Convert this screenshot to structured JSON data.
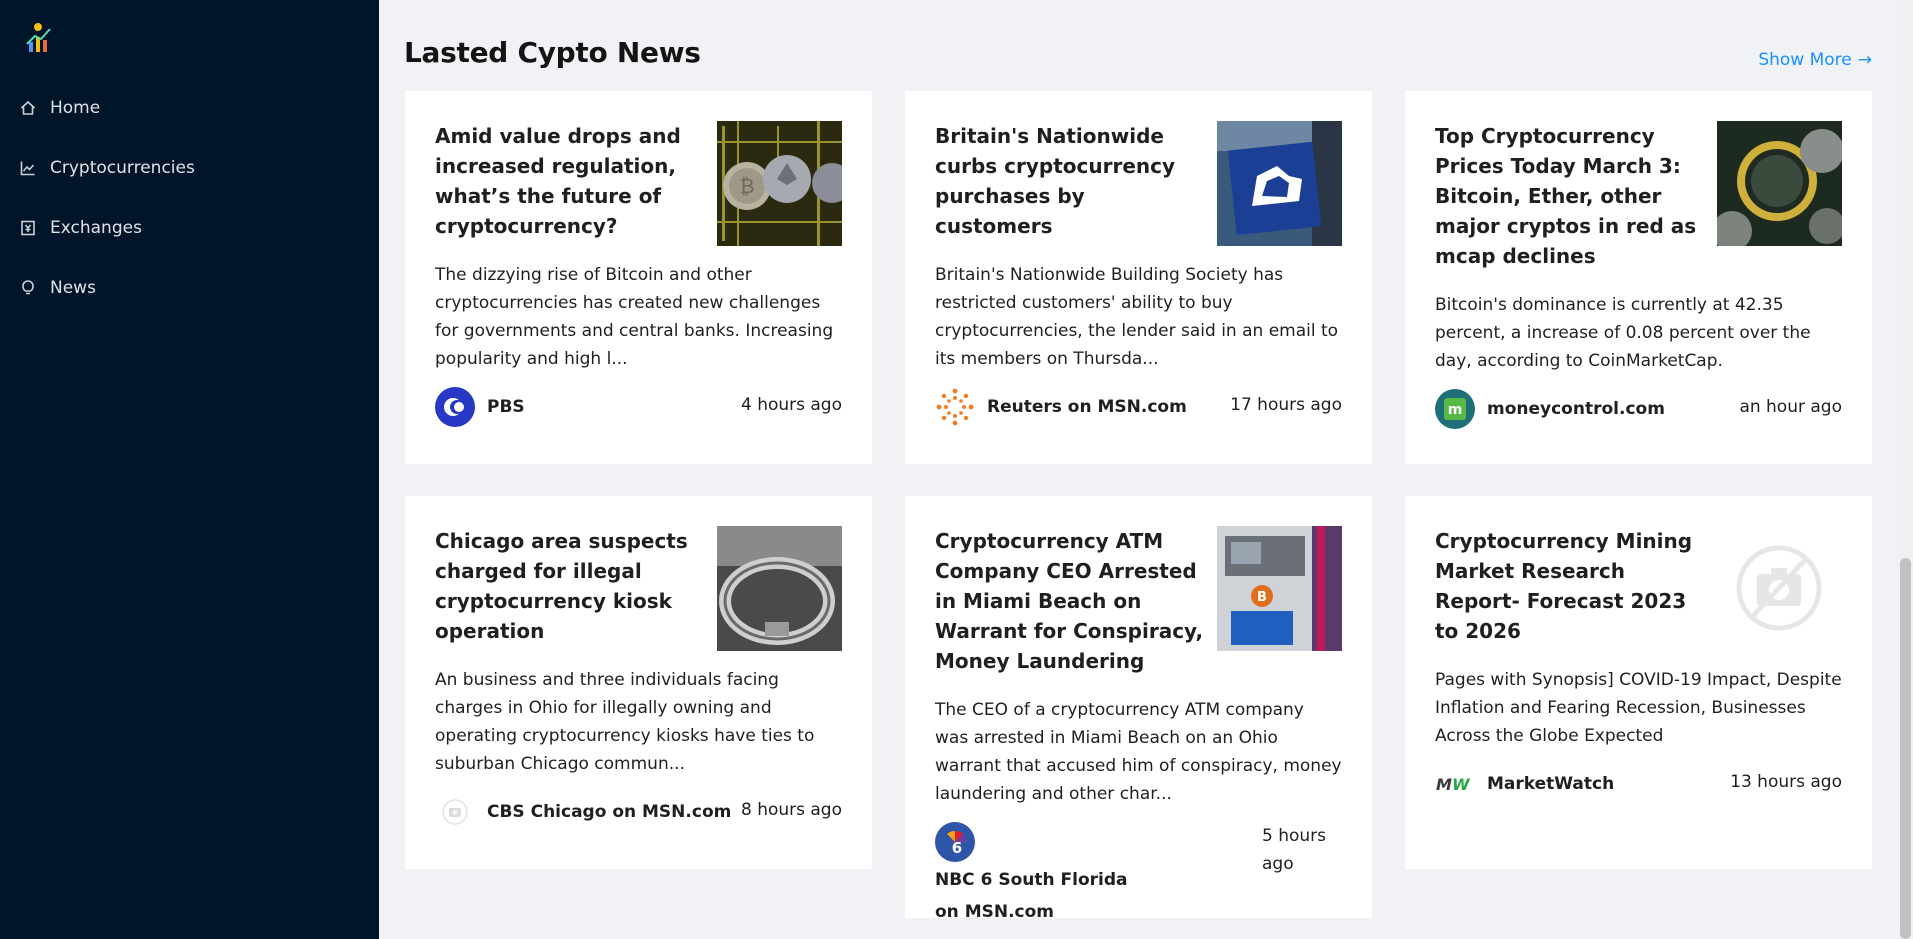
{
  "sidebar": {
    "items": [
      {
        "label": "Home",
        "icon": "home-icon"
      },
      {
        "label": "Cryptocurrencies",
        "icon": "chart-icon"
      },
      {
        "label": "Exchanges",
        "icon": "money-collect-icon"
      },
      {
        "label": "News",
        "icon": "bulb-icon"
      }
    ]
  },
  "main": {
    "title": "Lasted Cypto News",
    "show_more": "Show More",
    "show_more_icon": "arrow-right-icon"
  },
  "news": [
    {
      "title": "Amid value drops and increased regulation, what’s the future of cryptocurrency?",
      "description": "The dizzying rise of Bitcoin and other cryptocurrencies has created new challenges for governments and central banks. Increasing popularity and high l...",
      "provider": "PBS",
      "time": "4 hours ago"
    },
    {
      "title": "Britain's Nationwide curbs cryptocurrency purchases by customers",
      "description": "Britain's Nationwide Building Society has restricted customers' ability to buy cryptocurrencies, the lender said in an email to its members on Thursda...",
      "provider": "Reuters on MSN.com",
      "time": "17 hours ago"
    },
    {
      "title": "Top Cryptocurrency Prices Today March 3: Bitcoin, Ether, other major cryptos in red as mcap declines",
      "description": "Bitcoin's dominance is currently at 42.35 percent, a increase of 0.08 percent over the day, according to CoinMarketCap.",
      "provider": "moneycontrol.com",
      "time": "an hour ago"
    },
    {
      "title": "Chicago area suspects charged for illegal cryptocurrency kiosk operation",
      "description": "An business and three individuals facing charges in Ohio for illegally owning and operating cryptocurrency kiosks have ties to suburban Chicago commun...",
      "provider": "CBS Chicago on MSN.com",
      "time": "8 hours ago"
    },
    {
      "title": "Cryptocurrency ATM Company CEO Arrested in Miami Beach on Warrant for Conspiracy, Money Laundering",
      "description": "The CEO of a cryptocurrency ATM company was arrested in Miami Beach on an Ohio warrant that accused him of conspiracy, money laundering and other char...",
      "provider": "NBC 6 South Florida on MSN.com",
      "time": "5 hours ago"
    },
    {
      "title": "Cryptocurrency Mining Market Research Report- Forecast 2023 to 2026",
      "description": "Pages with Synopsis] COVID-19 Impact, Despite Inflation and Fearing Recession, Businesses Across the Globe Expected",
      "provider": "MarketWatch",
      "time": "13 hours ago"
    }
  ],
  "colors": {
    "sidebar_bg": "#001529",
    "page_bg": "#f0f2f5",
    "link": "#1890ff"
  }
}
